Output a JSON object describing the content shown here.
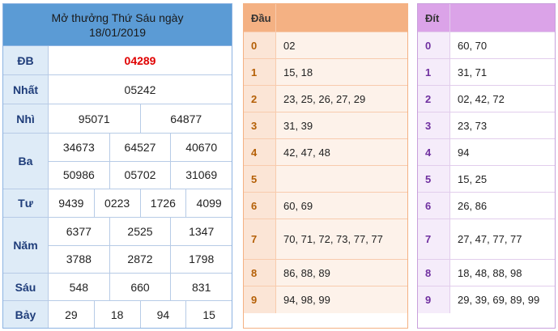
{
  "results": {
    "title_line1": "Mở thưởng Thứ Sáu ngày",
    "title_line2": "18/01/2019",
    "rows": [
      {
        "label": "ĐB",
        "lines": [
          [
            "04289"
          ]
        ]
      },
      {
        "label": "Nhất",
        "lines": [
          [
            "05242"
          ]
        ]
      },
      {
        "label": "Nhì",
        "lines": [
          [
            "95071",
            "64877"
          ]
        ]
      },
      {
        "label": "Ba",
        "lines": [
          [
            "34673",
            "64527",
            "40670"
          ],
          [
            "50986",
            "05702",
            "31069"
          ]
        ]
      },
      {
        "label": "Tư",
        "lines": [
          [
            "9439",
            "0223",
            "1726",
            "4099"
          ]
        ]
      },
      {
        "label": "Năm",
        "lines": [
          [
            "6377",
            "2525",
            "1347"
          ],
          [
            "3788",
            "2872",
            "1798"
          ]
        ]
      },
      {
        "label": "Sáu",
        "lines": [
          [
            "548",
            "660",
            "831"
          ]
        ]
      },
      {
        "label": "Bảy",
        "lines": [
          [
            "29",
            "18",
            "94",
            "15"
          ]
        ]
      }
    ]
  },
  "dau": {
    "header": "Đầu",
    "rows": [
      {
        "key": "0",
        "value": "02"
      },
      {
        "key": "1",
        "value": "15, 18"
      },
      {
        "key": "2",
        "value": "23, 25, 26, 27, 29"
      },
      {
        "key": "3",
        "value": "31, 39"
      },
      {
        "key": "4",
        "value": "42, 47, 48"
      },
      {
        "key": "5",
        "value": ""
      },
      {
        "key": "6",
        "value": "60, 69"
      },
      {
        "key": "7",
        "value": "70, 71, 72, 73, 77, 77"
      },
      {
        "key": "8",
        "value": "86, 88, 89"
      },
      {
        "key": "9",
        "value": "94, 98, 99"
      }
    ]
  },
  "dit": {
    "header": "Đít",
    "rows": [
      {
        "key": "0",
        "value": "60, 70"
      },
      {
        "key": "1",
        "value": "31, 71"
      },
      {
        "key": "2",
        "value": "02, 42, 72"
      },
      {
        "key": "3",
        "value": "23, 73"
      },
      {
        "key": "4",
        "value": "94"
      },
      {
        "key": "5",
        "value": "15, 25"
      },
      {
        "key": "6",
        "value": "26, 86"
      },
      {
        "key": "7",
        "value": "27, 47, 77, 77"
      },
      {
        "key": "8",
        "value": "18, 48, 88, 98"
      },
      {
        "key": "9",
        "value": "29, 39, 69, 89, 99"
      }
    ]
  },
  "colors": {
    "results_header": "#5b9bd5",
    "special_prize": "#e00000",
    "dau_header": "#f4b183",
    "dit_header": "#dba3e8"
  }
}
